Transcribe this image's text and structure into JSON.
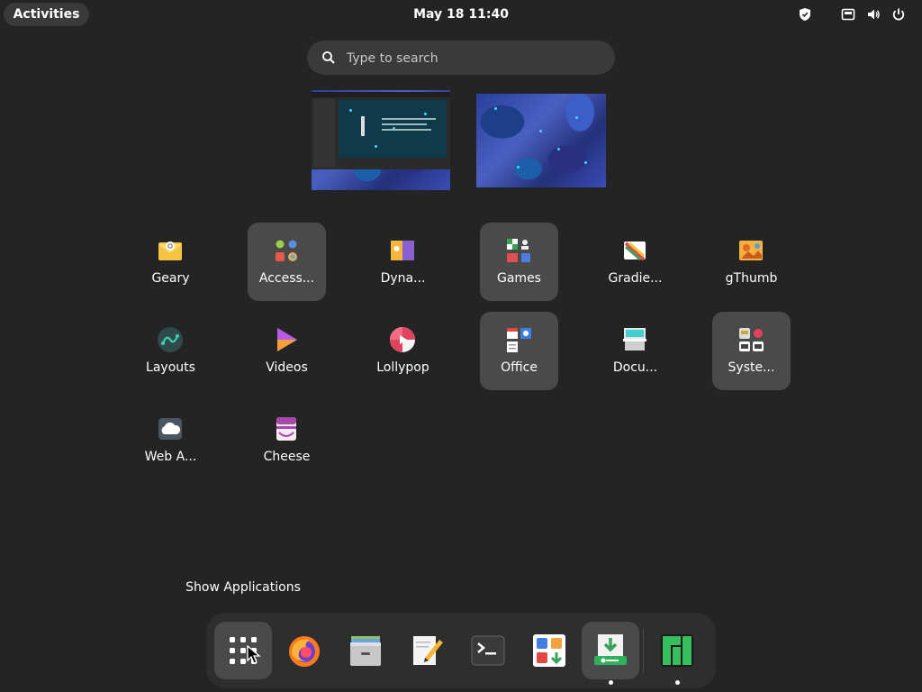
{
  "topbar": {
    "activities_label": "Activities",
    "clock": "May 18  11:40",
    "tray_icons": [
      "shield-icon",
      "network-wired-icon",
      "volume-icon",
      "power-icon"
    ]
  },
  "search": {
    "placeholder": "Type to search"
  },
  "workspaces": [
    {
      "name": "workspace-1",
      "has_window": true
    },
    {
      "name": "workspace-2",
      "has_window": false
    }
  ],
  "apps": [
    {
      "label": "Geary",
      "icon": "geary-icon",
      "folder": false
    },
    {
      "label": "Access...",
      "icon": "accessories-folder-icon",
      "folder": true
    },
    {
      "label": "Dyna...",
      "icon": "dynamic-wallpaper-icon",
      "folder": false
    },
    {
      "label": "Games",
      "icon": "games-folder-icon",
      "folder": true
    },
    {
      "label": "Gradie...",
      "icon": "gradience-icon",
      "folder": false
    },
    {
      "label": "gThumb",
      "icon": "gthumb-icon",
      "folder": false
    },
    {
      "label": "Layouts",
      "icon": "layouts-icon",
      "folder": false
    },
    {
      "label": "Videos",
      "icon": "videos-icon",
      "folder": false
    },
    {
      "label": "Lollypop",
      "icon": "lollypop-icon",
      "folder": false
    },
    {
      "label": "Office",
      "icon": "office-folder-icon",
      "folder": true
    },
    {
      "label": "Docu...",
      "icon": "document-scanner-icon",
      "folder": false
    },
    {
      "label": "Syste...",
      "icon": "system-folder-icon",
      "folder": true
    },
    {
      "label": "Web A...",
      "icon": "web-apps-icon",
      "folder": false
    },
    {
      "label": "Cheese",
      "icon": "cheese-icon",
      "folder": false
    }
  ],
  "show_applications_label": "Show Applications",
  "dock": {
    "items": [
      {
        "icon": "show-apps-grid-icon",
        "active": true,
        "running": false
      },
      {
        "icon": "firefox-icon",
        "active": false,
        "running": false
      },
      {
        "icon": "file-manager-icon",
        "active": false,
        "running": false
      },
      {
        "icon": "text-editor-icon",
        "active": false,
        "running": false
      },
      {
        "icon": "terminal-icon",
        "active": false,
        "running": false
      },
      {
        "icon": "software-center-icon",
        "active": false,
        "running": false
      },
      {
        "icon": "package-installer-icon",
        "active": true,
        "running": true
      },
      {
        "icon": "manjaro-logo-icon",
        "active": false,
        "running": true
      }
    ]
  },
  "colors": {
    "background": "#242424",
    "panel": "#3a3a3a",
    "folder_tile": "#4a4a4a",
    "dock": "#2e2e2e"
  }
}
